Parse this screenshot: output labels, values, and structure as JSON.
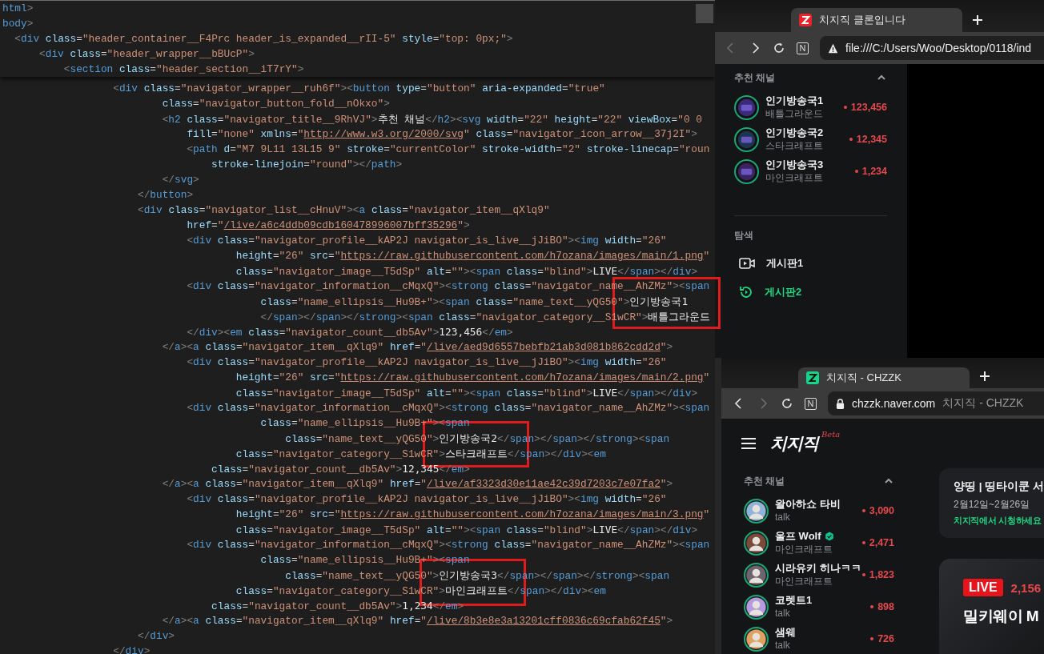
{
  "editor": {
    "pinned_lines": [
      "html>",
      "body>",
      "  <div class=\"header_container__F4Prc header_is_expanded__rII-5\" style=\"top: 0px;\">",
      "      <div class=\"header_wrapper__bBUcP\">",
      "          <section class=\"header_section__iT7rY\">"
    ],
    "lines": [
      "                  <div class=\"navigator_wrapper__ruh6f\"><button type=\"button\" aria-expanded=\"true\"",
      "                          class=\"navigator_button_fold__nOkxo\">",
      "                          <h2 class=\"navigator_title__9RhVJ\">추천 채널</h2><svg width=\"22\" height=\"22\" viewBox=\"0 0",
      "                              fill=\"none\" xmlns=\"http://www.w3.org/2000/svg\" class=\"navigator_icon_arrow__37j2I\">",
      "                              <path d=\"M7 9L11 13L15 9\" stroke=\"currentColor\" stroke-width=\"2\" stroke-linecap=\"roun",
      "                                  stroke-linejoin=\"round\"></path>",
      "                          </svg>",
      "                      </button>",
      "                      <div class=\"navigator_list__cHnuV\"><a class=\"navigator_item__qXlq9\"",
      "                              href=\"/live/a6c4ddb09cdb160478996007bff35296\">",
      "                              <div class=\"navigator_profile__kAP2J navigator_is_live__jJiBO\"><img width=\"26\"",
      "                                      height=\"26\" src=\"https://raw.githubusercontent.com/h7ozana/images/main/1.png\"",
      "                                      class=\"navigator_image__T5dSp\" alt=\"\"><span class=\"blind\">LIVE</span></div>",
      "                              <div class=\"navigator_information__cMqxQ\"><strong class=\"navigator_name__AhZMz\"><span",
      "                                          class=\"name_ellipsis__Hu9B+\"><span class=\"name_text__yQG50\">인기방송국1",
      "                                          </span></span></strong><span class=\"navigator_category__S1wCR\">배틀그라운드",
      "                              </div><em class=\"navigator_count__db5Av\">123,456</em>",
      "                          </a><a class=\"navigator_item__qXlq9\" href=\"/live/aed9d6557bebfb21ab3d081b862cdd2d\">",
      "                              <div class=\"navigator_profile__kAP2J navigator_is_live__jJiBO\"><img width=\"26\"",
      "                                      height=\"26\" src=\"https://raw.githubusercontent.com/h7ozana/images/main/2.png\"",
      "                                      class=\"navigator_image__T5dSp\" alt=\"\"><span class=\"blind\">LIVE</span></div>",
      "                              <div class=\"navigator_information__cMqxQ\"><strong class=\"navigator_name__AhZMz\"><span",
      "                                          class=\"name_ellipsis__Hu9B+\"><span",
      "                                              class=\"name_text__yQG50\">인기방송국2</span></span></strong><span",
      "                                      class=\"navigator_category__S1wCR\">스타크래프트</span></div><em",
      "                                  class=\"navigator_count__db5Av\">12,345</em>",
      "                          </a><a class=\"navigator_item__qXlq9\" href=\"/live/af3323d30e11ae42c39d7203c7e07fa2\">",
      "                              <div class=\"navigator_profile__kAP2J navigator_is_live__jJiBO\"><img width=\"26\"",
      "                                      height=\"26\" src=\"https://raw.githubusercontent.com/h7ozana/images/main/3.png\"",
      "                                      class=\"navigator_image__T5dSp\" alt=\"\"><span class=\"blind\">LIVE</span></div>",
      "                              <div class=\"navigator_information__cMqxQ\"><strong class=\"navigator_name__AhZMz\"><span",
      "                                          class=\"name_ellipsis__Hu9B+\"><span",
      "                                              class=\"name_text__yQG50\">인기방송국3</span></span></strong><span",
      "                                      class=\"navigator_category__S1wCR\">마인크래프트</span></div><em",
      "                                  class=\"navigator_count__db5Av\">1,234</em>",
      "                          </a><a class=\"navigator_item__qXlq9\" href=\"/live/8b3e8e3a13201cff0836c69cfab62f45\">",
      "                      </div>",
      "                  </div>"
    ]
  },
  "clone_window": {
    "tab": {
      "title": "치지직 클론입니다"
    },
    "back": {
      "disabled": true
    },
    "forward": {
      "disabled": false
    },
    "extension": "N",
    "address": "file:///C:/Users/Woo/Desktop/0118/ind",
    "sidebar": {
      "section_title": "추천 채널",
      "channels": [
        {
          "name": "인기방송국1",
          "category": "배틀그라운드",
          "viewers": "123,456"
        },
        {
          "name": "인기방송국2",
          "category": "스타크래프트",
          "viewers": "12,345"
        },
        {
          "name": "인기방송국3",
          "category": "마인크래프트",
          "viewers": "1,234"
        }
      ],
      "explore_title": "탐색",
      "menu": [
        {
          "label": "게시판1",
          "kind": "video",
          "selected": false
        },
        {
          "label": "게시판2",
          "kind": "history",
          "selected": true
        }
      ]
    }
  },
  "chzzk_window": {
    "tab": {
      "title": "치지직 - CHZZK"
    },
    "back": {
      "disabled": false
    },
    "forward": {
      "disabled": true
    },
    "extension": "N",
    "address": {
      "domain": "chzzk.naver.com",
      "page_title": "치지직 - CHZZK"
    },
    "logo": "치지직",
    "logo_badge": "Beta",
    "sidebar": {
      "section_title": "추천 채널",
      "channels": [
        {
          "name": "왈아하쇼 타비",
          "category": "talk",
          "viewers": "3,090",
          "verified": false
        },
        {
          "name": "울프 Wolf",
          "category": "마인크래프트",
          "viewers": "2,471",
          "verified": true
        },
        {
          "name": "시라유키 히나ㅋㅋ",
          "category": "마인크래프트",
          "viewers": "1,823",
          "verified": false
        },
        {
          "name": "코렛트1",
          "category": "talk",
          "viewers": "898",
          "verified": false
        },
        {
          "name": "샘웨",
          "category": "talk",
          "viewers": "726",
          "verified": false
        }
      ]
    },
    "event_card": {
      "title": "양띵 | 띵타이쿤 서",
      "dates": "2월12일~2월26일",
      "action": "치지직에서 시청하세요"
    },
    "live_card": {
      "badge": "LIVE",
      "viewers": "2,156",
      "title": "밀키웨이 M"
    }
  }
}
